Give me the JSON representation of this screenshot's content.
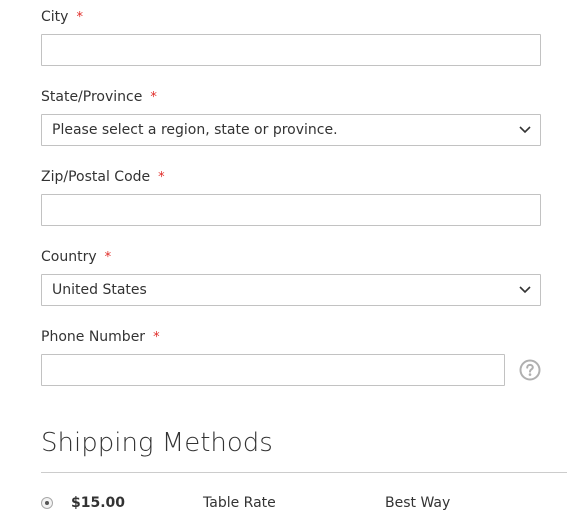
{
  "form": {
    "city": {
      "label": "City",
      "required_mark": "*",
      "value": ""
    },
    "state": {
      "label": "State/Province",
      "required_mark": "*",
      "selected": "Please select a region, state or province."
    },
    "zip": {
      "label": "Zip/Postal Code",
      "required_mark": "*",
      "value": ""
    },
    "country": {
      "label": "Country",
      "required_mark": "*",
      "selected": "United States"
    },
    "phone": {
      "label": "Phone Number",
      "required_mark": "*",
      "value": "",
      "help_icon": "question-circle-icon"
    }
  },
  "shipping": {
    "title": "Shipping Methods",
    "methods": [
      {
        "selected": true,
        "price": "$15.00",
        "method": "Table Rate",
        "carrier": "Best Way"
      }
    ]
  },
  "colors": {
    "required": "#e02b27",
    "border": "#c2c2c2",
    "text": "#333333"
  }
}
